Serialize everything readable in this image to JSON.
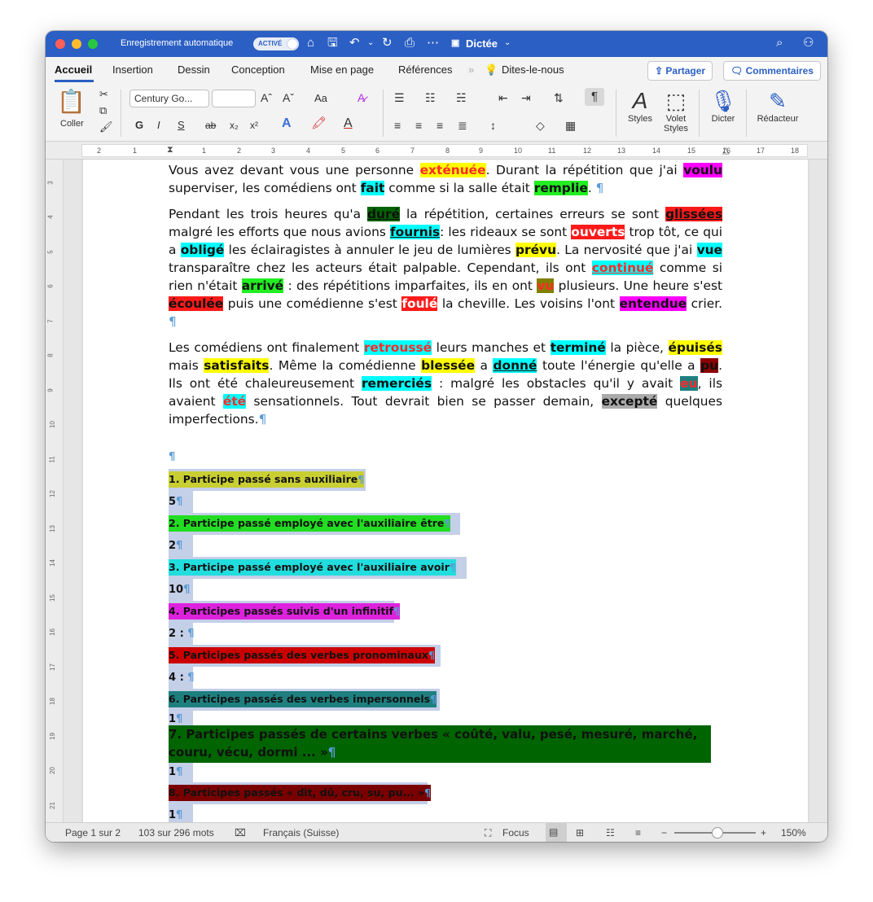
{
  "titlebar": {
    "autosave_label": "Enregistrement automatique",
    "autosave_state": "ACTIVÉ",
    "doc_title": "Dictée"
  },
  "tabs": [
    "Accueil",
    "Insertion",
    "Dessin",
    "Conception",
    "Mise en page",
    "Références"
  ],
  "tell_me": "Dites-le-nous",
  "share_label": "Partager",
  "comments_label": "Commentaires",
  "ribbon": {
    "paste_label": "Coller",
    "font_name": "Century Go...",
    "font_size": "",
    "styles_label": "Styles",
    "styles_pane_label": "Volet Styles",
    "dictate_label": "Dicter",
    "editor_label": "Rédacteur",
    "bold": "G",
    "italic": "I",
    "underline": "S",
    "strike": "ab",
    "subscript": "x₂",
    "superscript": "x²",
    "grow_font": "Aˆ",
    "shrink_font": "Aˇ",
    "case": "Aa"
  },
  "ruler_numbers": [
    "2",
    "1",
    "1",
    "2",
    "3",
    "4",
    "5",
    "6",
    "7",
    "8",
    "9",
    "10",
    "11",
    "12",
    "13",
    "14",
    "15",
    "16",
    "17",
    "18"
  ],
  "vruler_numbers": [
    "3",
    "4",
    "5",
    "6",
    "7",
    "8",
    "9",
    "10",
    "11",
    "12",
    "13",
    "14",
    "15",
    "16",
    "17",
    "18",
    "19",
    "20",
    "21"
  ],
  "para1": {
    "t1": "Vous avez devant vous une personne ",
    "w1": "exténuée",
    "t2": ". Durant la répétition que j'ai ",
    "w2": "voulu",
    "t3": " superviser, les comédiens ont ",
    "w3": "fait",
    "t4": " comme si la salle était ",
    "w4": "remplie",
    "t5": ". "
  },
  "para2": {
    "t1": "Pendant les trois heures qu'a ",
    "w1": "duré",
    "t2": " la répétition, certaines erreurs se sont ",
    "w2": "glissées",
    "t3": " malgré les efforts que nous avions ",
    "w3": "fournis",
    "t4": ": les rideaux se sont ",
    "w4": "ouverts",
    "t5": " trop tôt, ce qui a ",
    "w5": "obligé",
    "t6": " les éclairagistes à annuler le jeu de lumières ",
    "w6": "prévu",
    "t7": ". La nervosité que j'ai ",
    "w7": "vue",
    "t8": " transparaître chez les acteurs était palpable. Cependant, ils ont ",
    "w8": "continué",
    "t9": " comme si rien n'était ",
    "w9": "arrivé",
    "t10": " : des répétitions imparfaites, ils en ont ",
    "w10": "vu",
    "t11": " plusieurs. Une heure s'est ",
    "w11": "écoulée",
    "t12": " puis une comédienne s'est ",
    "w12": "foulé",
    "t13": " la cheville. Les voisins l'ont ",
    "w13": "entendue",
    "t14": " crier. "
  },
  "para3": {
    "t1": "Les comédiens ont finalement ",
    "w1": "retroussé",
    "t2": " leurs manches et ",
    "w2": "terminé",
    "t3": " la pièce, ",
    "w3": "épuisés",
    "t4": " mais ",
    "w4": "satisfaits",
    "t5": ". Même la comédienne ",
    "w5": "blessée",
    "t6": " a ",
    "w6": "donné",
    "t7": " toute l'énergie qu'elle a ",
    "w7": "pu",
    "t8": ". Ils ont été chaleureusement ",
    "w8": "remerciés",
    "t9": " : malgré les obstacles qu'il y avait ",
    "w9": "eu",
    "t10": ", ils avaient ",
    "w10": "été",
    "t11": " sensationnels. Tout devrait bien se passer demain, ",
    "w11": "excepté",
    "t12": " quelques imperfections."
  },
  "pilcrow": "¶",
  "categories": [
    {
      "label": "1. Participe passé sans auxiliaire",
      "count": "5",
      "color": "#c9cf32"
    },
    {
      "label": "2. Participe passé employé avec l'auxiliaire être",
      "count": "2",
      "color": "#22dd22"
    },
    {
      "label": "3. Participe passé employé avec l'auxiliaire avoir",
      "count": "10",
      "color": "#22dddd"
    },
    {
      "label": "4. Participes passés suivis d'un infinitif",
      "count": "2 : ",
      "color": "#dd22dd"
    },
    {
      "label": "5. Participes passés des verbes pronominaux",
      "count": "4 : ",
      "color": "#cc0000"
    },
    {
      "label": "6. Participes passés des verbes impersonnels",
      "count": "1",
      "color": "#1e7f7f"
    },
    {
      "label": "7. Participes passés de certains verbes « coûté, valu, pesé, mesuré, marché, couru, vécu, dormi ... »",
      "count": "1",
      "color": "#006400"
    },
    {
      "label": "8. Participes passés « dit, dû, cru, su, pu... »",
      "count": "1",
      "color": "#7a0000"
    }
  ],
  "status": {
    "page": "Page 1 sur 2",
    "words": "103 sur 296 mots",
    "language": "Français (Suisse)",
    "focus": "Focus",
    "zoom": "150%"
  }
}
